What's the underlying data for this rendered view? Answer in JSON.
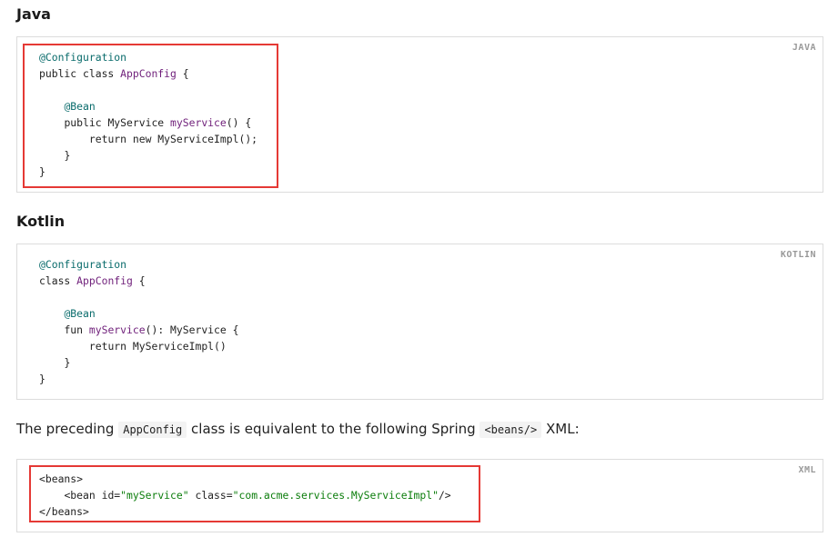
{
  "sections": {
    "java": {
      "heading": "Java",
      "lang_tag": "JAVA",
      "lines": {
        "l1": {
          "annot": "@Configuration"
        },
        "l2": {
          "p1": "public class ",
          "ident": "AppConfig",
          "p2": " {"
        },
        "l4": {
          "annot": "@Bean"
        },
        "l5": {
          "p1": "public MyService ",
          "ident": "myService",
          "p2": "() {"
        },
        "l6": {
          "p1": "return new MyServiceImpl();"
        },
        "l7": {
          "p1": "}"
        },
        "l8": {
          "p1": "}"
        }
      }
    },
    "kotlin": {
      "heading": "Kotlin",
      "lang_tag": "KOTLIN",
      "lines": {
        "l1": {
          "annot": "@Configuration"
        },
        "l2": {
          "p1": "class ",
          "ident": "AppConfig",
          "p2": " {"
        },
        "l4": {
          "annot": "@Bean"
        },
        "l5": {
          "p1": "fun ",
          "ident": "myService",
          "p2": "(): MyService {"
        },
        "l6": {
          "p1": "return MyServiceImpl()"
        },
        "l7": {
          "p1": "}"
        },
        "l8": {
          "p1": "}"
        }
      }
    },
    "paragraph": {
      "text1": "The preceding",
      "code1": "AppConfig",
      "text2": "class is equivalent to the following Spring",
      "code2": "<beans/>",
      "text3": "XML:"
    },
    "xml": {
      "lang_tag": "XML",
      "lines": {
        "l1": {
          "p1": "<beans>"
        },
        "l2": {
          "p1": "<bean id=",
          "s1": "\"myService\"",
          "p2": " class=",
          "s2": "\"com.acme.services.MyServiceImpl\"",
          "p3": "/>"
        },
        "l3": {
          "p1": "</beans>"
        }
      }
    }
  },
  "colors": {
    "highlight": "#e53935",
    "annotation": "#0a6c6c",
    "identifier": "#6f1f7a",
    "string": "#0b7d0b",
    "border": "#dcdcdc"
  }
}
